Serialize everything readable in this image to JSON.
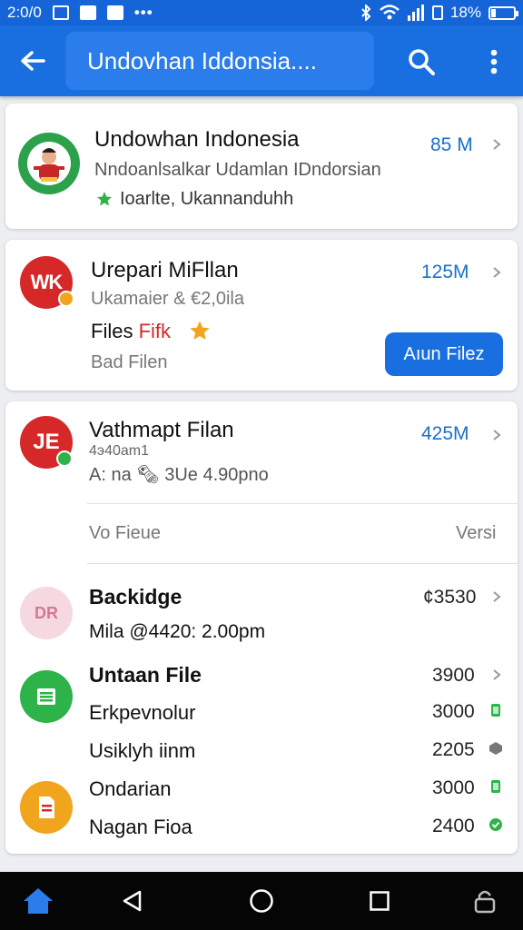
{
  "status_bar": {
    "time": "2:0/0",
    "dots": "•••",
    "battery_text": "18%",
    "battery_level": 0.18
  },
  "app_bar": {
    "title": "Undovhan Iddonsia....",
    "icons": [
      "back-arrow-icon",
      "search-icon",
      "more-vert-icon"
    ]
  },
  "cards": {
    "first": {
      "title": "Undowhan Indonesia",
      "subtitle": "Nndoanlsalkar Udamlan IDndorsian",
      "tag": "Ioarlte, Ukannanduhh",
      "size": "85 M",
      "accent": "#1a6fc9"
    },
    "second": {
      "title": "Urepari MiFllan",
      "subtitle": "Ukamaier & €2,0ila",
      "files_prefix": "Files ",
      "files_red": "Fifk",
      "status": "Bad Filen",
      "size": "125M",
      "button_label": "Aıun Filez",
      "avatar_text": "WK"
    },
    "third": {
      "title": "Vathmapt Filan",
      "line1": "4э40аm1",
      "line2": "A: na 🗞 3Ue 4.90pno",
      "size": "425M",
      "avatar_text": "JE",
      "header_left": "Vo Fieue",
      "header_right": "Versi",
      "rows": [
        {
          "title": "Backidge",
          "value": "¢3530",
          "sub": "Mila @4420: 2.00pm"
        },
        {
          "title": "Untaan File",
          "value": "3900"
        },
        {
          "title": "Erkpevnolur",
          "value": "3000"
        },
        {
          "title": "Usiklyh iinm",
          "value": "2205"
        },
        {
          "title": "Ondarian",
          "value": "3000"
        },
        {
          "title": "Nagan Fioa",
          "value": "2400"
        }
      ],
      "avatar_backidge_text": "DR"
    }
  },
  "colors": {
    "primary": "#1a6fe0",
    "status": "#1565d8",
    "size_blue": "#1a6fc9",
    "green": "#2db34a",
    "red": "#d62828",
    "orange": "#f1a51d"
  },
  "nav_bar": {
    "icons": [
      "home-icon",
      "back-triangle-icon",
      "home-circle-icon",
      "recents-square-icon",
      "lock-icon"
    ]
  }
}
